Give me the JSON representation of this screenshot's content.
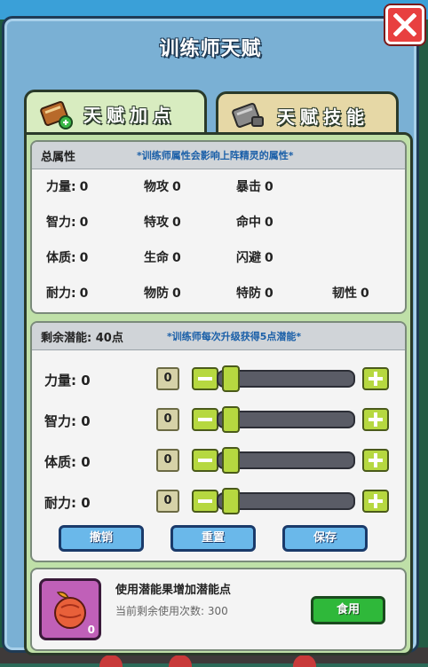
{
  "window": {
    "title": "训练师天赋",
    "close_icon": "close-icon"
  },
  "tabs": [
    {
      "label": "天赋加点",
      "icon": "book-plus-icon",
      "active": true
    },
    {
      "label": "天赋技能",
      "icon": "book-lock-icon",
      "active": false
    }
  ],
  "total_attributes": {
    "header": "总属性",
    "note": "*训练师属性会影响上阵精灵的属性*",
    "items": [
      {
        "label": "力量:",
        "value": "0"
      },
      {
        "label": "物攻",
        "value": "0"
      },
      {
        "label": "暴击",
        "value": "0"
      },
      {
        "label": "智力:",
        "value": "0"
      },
      {
        "label": "特攻",
        "value": "0"
      },
      {
        "label": "命中",
        "value": "0"
      },
      {
        "label": "体质:",
        "value": "0"
      },
      {
        "label": "生命",
        "value": "0"
      },
      {
        "label": "闪避",
        "value": "0"
      },
      {
        "label": "耐力:",
        "value": "0"
      },
      {
        "label": "物防",
        "value": "0"
      },
      {
        "label": "特防",
        "value": "0"
      },
      {
        "label": "韧性",
        "value": "0"
      }
    ]
  },
  "potential": {
    "header_label": "剩余潜能:",
    "header_value": "40点",
    "note": "*训练师每次升级获得5点潜能*",
    "rows": [
      {
        "label": "力量: 0",
        "value": "0",
        "slider_fraction": 0
      },
      {
        "label": "智力: 0",
        "value": "0",
        "slider_fraction": 0
      },
      {
        "label": "体质: 0",
        "value": "0",
        "slider_fraction": 0
      },
      {
        "label": "耐力: 0",
        "value": "0",
        "slider_fraction": 0
      }
    ],
    "buttons": {
      "undo": "撤销",
      "reset": "重置",
      "save": "保存"
    }
  },
  "fruit": {
    "icon": "potential-fruit-icon",
    "count": "0",
    "title": "使用潜能果增加潜能点",
    "remaining_label": "当前剩余使用次数:",
    "remaining_value": "300",
    "eat_button": "食用"
  },
  "colors": {
    "panel": "#7ab0d4",
    "content": "#bfe0a8",
    "accent_green": "#b6d840",
    "button_blue": "#6ab8ea",
    "eat_green": "#2fb83a",
    "close_red": "#e84040"
  }
}
